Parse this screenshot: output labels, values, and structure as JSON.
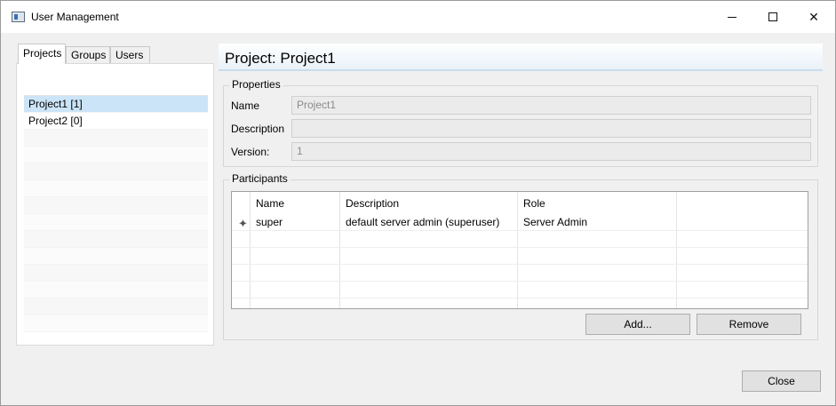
{
  "window": {
    "title": "User Management",
    "controls": {
      "minimize": "minimize",
      "maximize": "maximize",
      "close": "✕"
    }
  },
  "tabs": [
    {
      "label": "Projects",
      "active": true
    },
    {
      "label": "Groups",
      "active": false
    },
    {
      "label": "Users",
      "active": false
    }
  ],
  "project_list": {
    "items": [
      {
        "label": "Project1 [1]",
        "selected": true
      },
      {
        "label": "Project2 [0]",
        "selected": false
      }
    ]
  },
  "header": {
    "title": "Project: Project1"
  },
  "properties": {
    "legend": "Properties",
    "name_label": "Name",
    "name_value": "Project1",
    "description_label": "Description",
    "description_value": "",
    "version_label": "Version:",
    "version_value": "1"
  },
  "participants": {
    "legend": "Participants",
    "columns": [
      "Name",
      "Description",
      "Role"
    ],
    "rows": [
      {
        "name": "super",
        "description": "default server admin (superuser)",
        "role": "Server Admin"
      }
    ],
    "add_label": "Add...",
    "remove_label": "Remove"
  },
  "footer": {
    "close_label": "Close"
  },
  "colors": {
    "selection": "#cce4f7",
    "header_rule": "#c8dced"
  }
}
